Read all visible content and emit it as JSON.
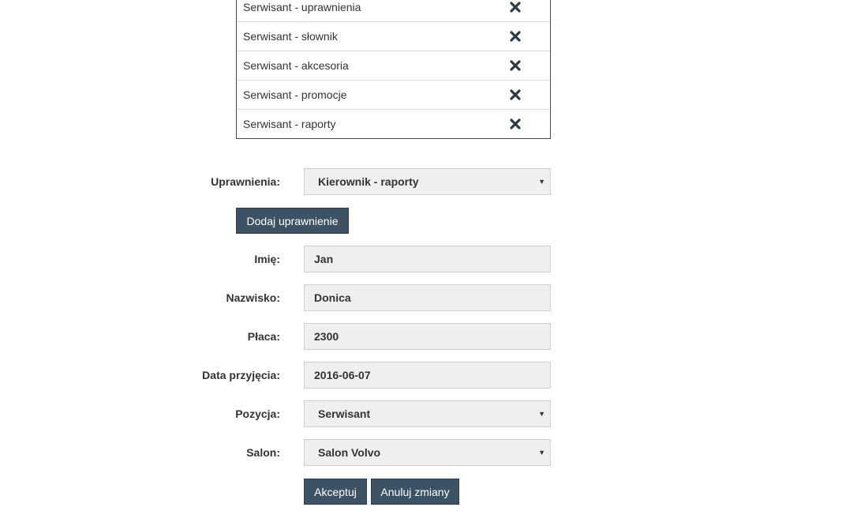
{
  "permissions": {
    "rows": [
      {
        "label": "Serwisant - uprawnienia"
      },
      {
        "label": "Serwisant - słownik"
      },
      {
        "label": "Serwisant - akcesoria"
      },
      {
        "label": "Serwisant - promocje"
      },
      {
        "label": "Serwisant - raporty"
      }
    ],
    "remove_icon": "close-icon"
  },
  "form": {
    "permissions_label": "Uprawnienia:",
    "permissions_value": "Kierownik - raporty",
    "add_permission_button": "Dodaj uprawnienie",
    "first_name_label": "Imię:",
    "first_name_value": "Jan",
    "last_name_label": "Nazwisko:",
    "last_name_value": "Donica",
    "salary_label": "Płaca:",
    "salary_value": "2300",
    "hire_date_label": "Data przyjęcia:",
    "hire_date_value": "2016-06-07",
    "position_label": "Pozycja:",
    "position_value": "Serwisant",
    "salon_label": "Salon:",
    "salon_value": "Salon Volvo",
    "accept_button": "Akceptuj",
    "cancel_button": "Anuluj zmiany"
  },
  "colors": {
    "button_bg": "#3c5366",
    "field_bg": "#efefef",
    "table_border": "#2f4f6f"
  }
}
